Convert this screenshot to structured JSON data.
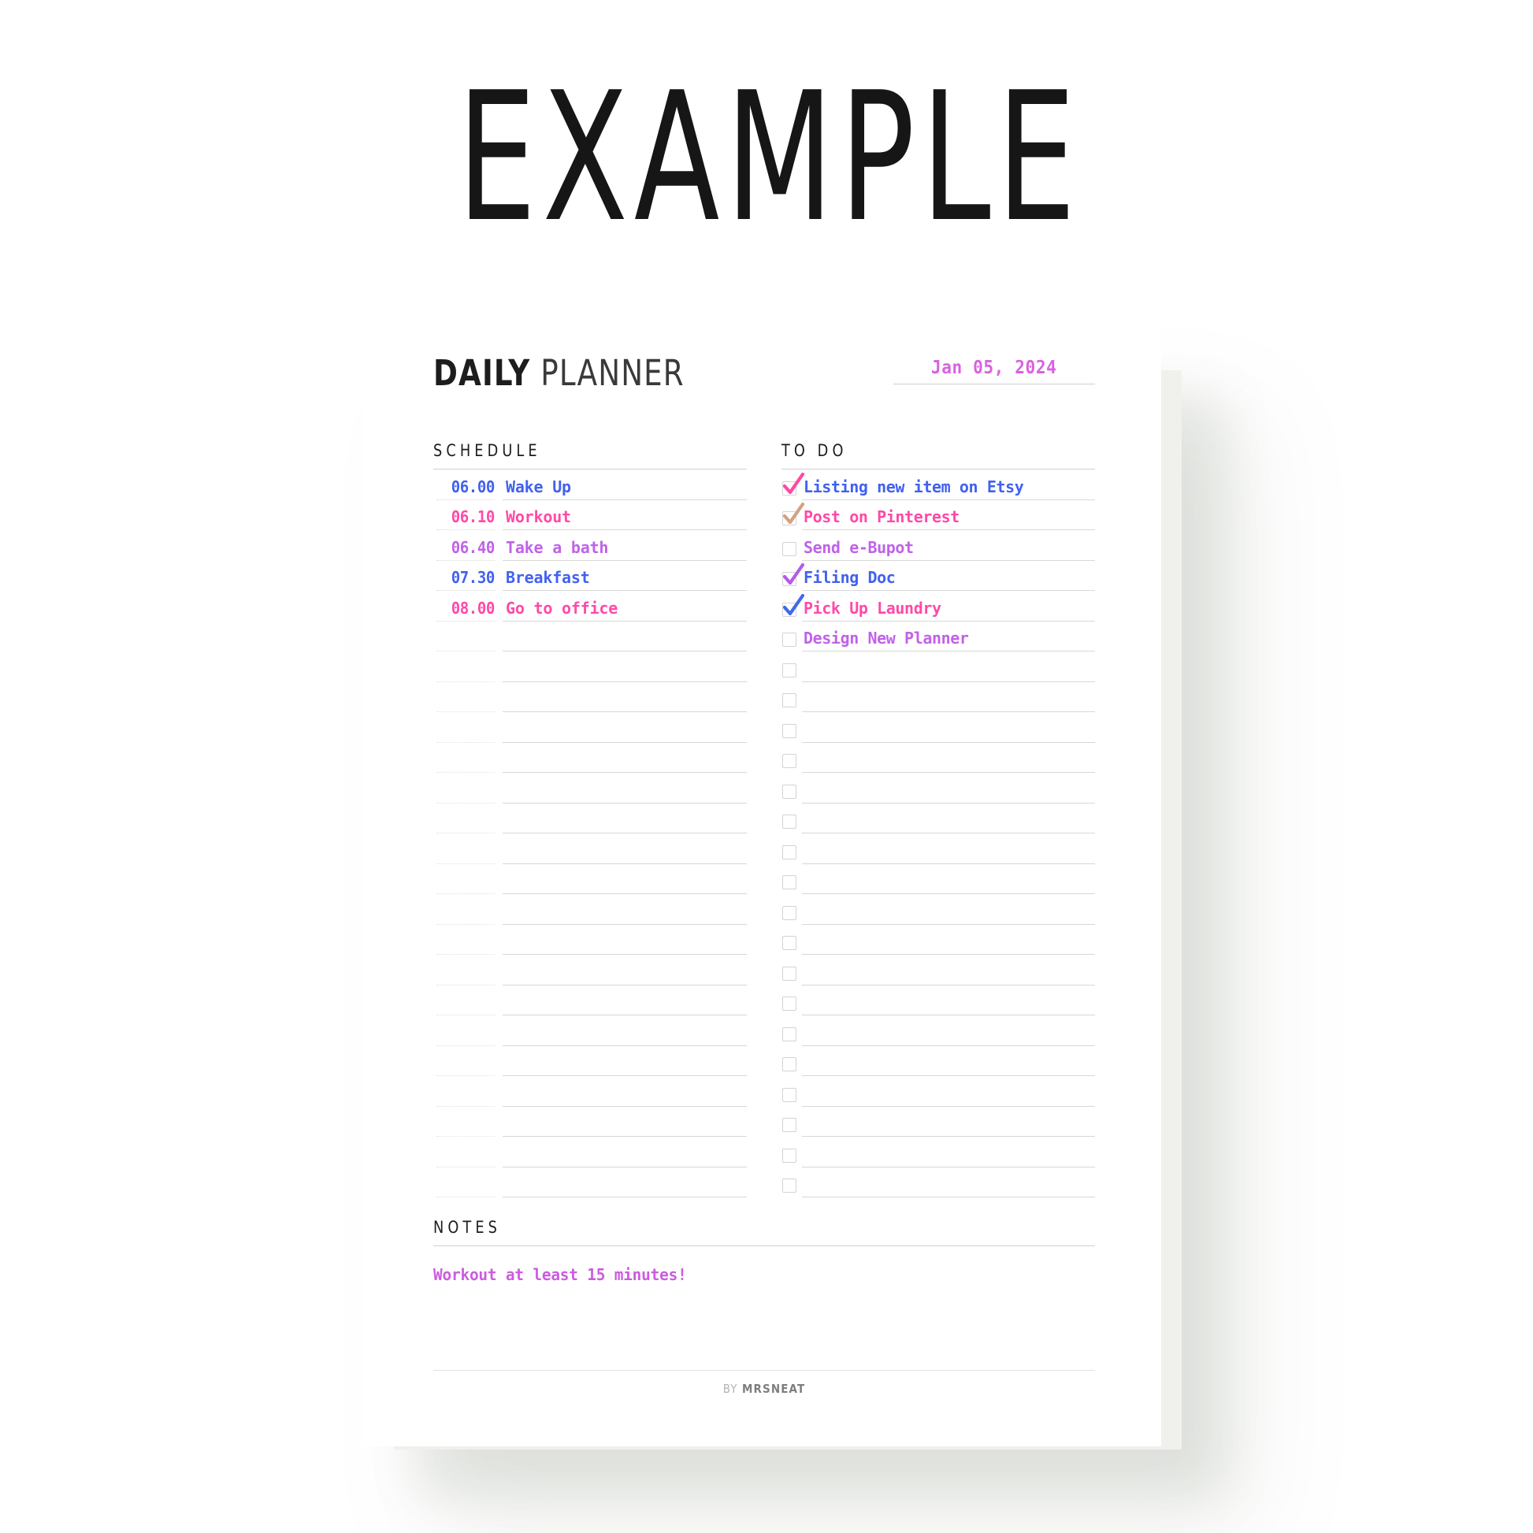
{
  "watermark": {
    "text": "EXAMPLE"
  },
  "header": {
    "title_bold": "DAILY",
    "title_light": " PLANNER",
    "date_value": "Jan 05, 2024"
  },
  "colors": {
    "blue": "#4161f0",
    "pink": "#ff49a8",
    "purple": "#c062e8",
    "orchid": "#d862e0",
    "tan": "#d2a283",
    "rule": "#d9d9d9",
    "checkbox_border": "#d3d3d3",
    "heading": "#1d1d1d"
  },
  "schedule": {
    "label": "SCHEDULE",
    "filled_rows": [
      {
        "time": "06.00",
        "task": "Wake Up",
        "color": "#4161f0"
      },
      {
        "time": "06.10",
        "task": "Workout",
        "color": "#ff49a8"
      },
      {
        "time": "06.40",
        "task": "Take a bath",
        "color": "#c062e8"
      },
      {
        "time": "07.30",
        "task": "Breakfast",
        "color": "#4161f0"
      },
      {
        "time": "08.00",
        "task": "Go to office",
        "color": "#ff49a8"
      }
    ],
    "empty_row_count": 19
  },
  "todo": {
    "label": "TO DO",
    "filled_rows": [
      {
        "text": "Listing new item on Etsy",
        "color": "#4161f0",
        "checked": true,
        "tick_color": "#ff49a8"
      },
      {
        "text": "Post on Pinterest",
        "color": "#ff49a8",
        "checked": true,
        "tick_color": "#d2a283"
      },
      {
        "text": "Send e-Bupot",
        "color": "#c062e8",
        "checked": false,
        "tick_color": ""
      },
      {
        "text": "Filing Doc",
        "color": "#4161f0",
        "checked": true,
        "tick_color": "#b45ce8"
      },
      {
        "text": "Pick Up Laundry",
        "color": "#ff49a8",
        "checked": true,
        "tick_color": "#3f6ae8"
      },
      {
        "text": "Design New Planner",
        "color": "#c062e8",
        "checked": false,
        "tick_color": ""
      }
    ],
    "empty_row_count": 18
  },
  "notes": {
    "label": "NOTES",
    "body": "Workout at least 15 minutes!"
  },
  "footer": {
    "by": "BY ",
    "name": "MRSNEAT"
  }
}
